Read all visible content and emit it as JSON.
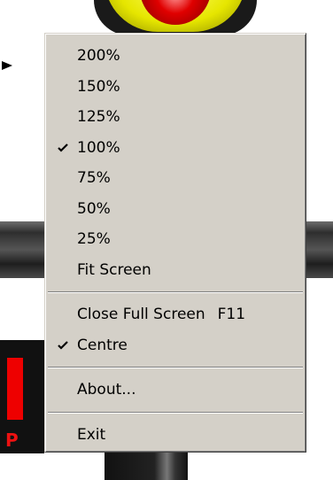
{
  "menu": {
    "zoom_items": [
      {
        "label": "200%",
        "checked": false
      },
      {
        "label": "150%",
        "checked": false
      },
      {
        "label": "125%",
        "checked": false
      },
      {
        "label": "100%",
        "checked": true
      },
      {
        "label": "75%",
        "checked": false
      },
      {
        "label": "50%",
        "checked": false
      },
      {
        "label": "25%",
        "checked": false
      },
      {
        "label": "Fit Screen",
        "checked": false
      }
    ],
    "close_full_screen": {
      "label": "Close Full Screen",
      "shortcut": "F11"
    },
    "centre": {
      "label": "Centre",
      "checked": true
    },
    "about": {
      "label": "About..."
    },
    "exit": {
      "label": "Exit"
    }
  },
  "background": {
    "partial_text": "P"
  },
  "colors": {
    "menu_bg": "#d4d0c8",
    "lamp_yellow": "#e6e600",
    "lamp_red": "#e00000",
    "stop_red": "#ee1111"
  }
}
